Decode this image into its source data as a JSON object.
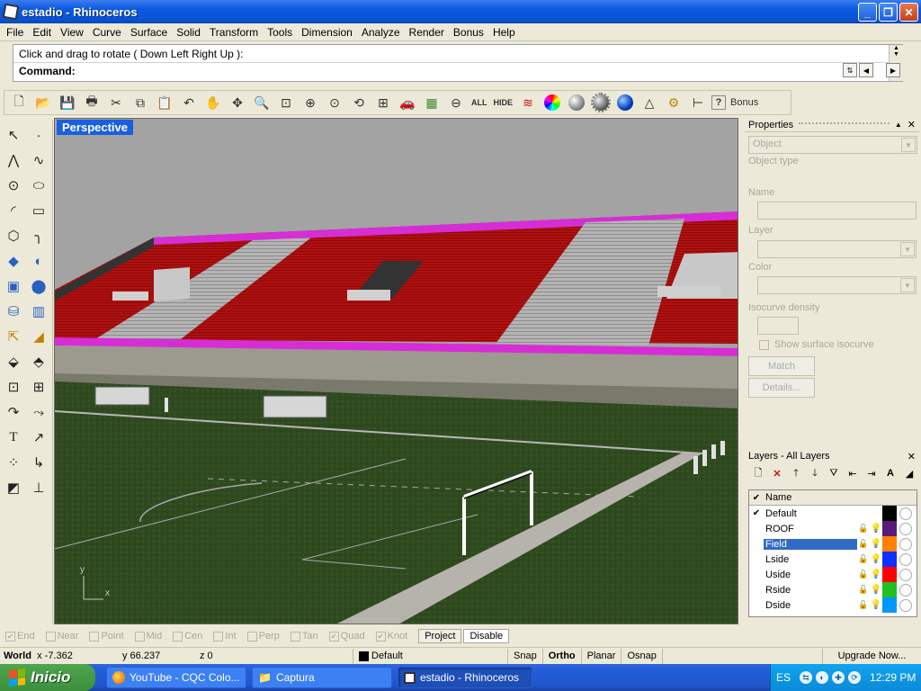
{
  "window": {
    "title": "estadio - Rhinoceros",
    "controls": [
      "_",
      "❐",
      "✕"
    ]
  },
  "menu": [
    "File",
    "Edit",
    "View",
    "Curve",
    "Surface",
    "Solid",
    "Transform",
    "Tools",
    "Dimension",
    "Analyze",
    "Render",
    "Bonus",
    "Help"
  ],
  "command": {
    "history": "Click and drag to rotate ( Down  Left  Right  Up ):",
    "prompt": "Command:"
  },
  "toolbar": {
    "all_label": "ALL",
    "hide_label": "HIDE",
    "bonus_label": "Bonus"
  },
  "viewport": {
    "title": "Perspective",
    "axis_y": "y",
    "axis_x": "x"
  },
  "properties": {
    "title": "Properties",
    "object_combo": "Object",
    "object_type_label": "Object type",
    "name_label": "Name",
    "layer_label": "Layer",
    "color_label": "Color",
    "isocurve_label": "Isocurve density",
    "show_isocurve_label": "Show surface isocurve",
    "match_button": "Match",
    "details_button": "Details..."
  },
  "layers": {
    "title": "Layers - All Layers",
    "name_header": "Name",
    "items": [
      {
        "name": "Default",
        "current": true,
        "color": "#000000"
      },
      {
        "name": "ROOF",
        "current": false,
        "color": "#5a1a7a"
      },
      {
        "name": "Field",
        "current": false,
        "color": "#ff8000",
        "selected": true
      },
      {
        "name": "Lside",
        "current": false,
        "color": "#1030ff"
      },
      {
        "name": "Uside",
        "current": false,
        "color": "#ff0000"
      },
      {
        "name": "Rside",
        "current": false,
        "color": "#20c020"
      },
      {
        "name": "Dside",
        "current": false,
        "color": "#0098ff"
      }
    ]
  },
  "osnap": {
    "items": [
      {
        "label": "End",
        "checked": true
      },
      {
        "label": "Near",
        "checked": false
      },
      {
        "label": "Point",
        "checked": false
      },
      {
        "label": "Mid",
        "checked": false
      },
      {
        "label": "Cen",
        "checked": false
      },
      {
        "label": "Int",
        "checked": false
      },
      {
        "label": "Perp",
        "checked": false
      },
      {
        "label": "Tan",
        "checked": false
      },
      {
        "label": "Quad",
        "checked": true
      },
      {
        "label": "Knot",
        "checked": true
      }
    ],
    "project_label": "Project",
    "disable_label": "Disable"
  },
  "status": {
    "world": "World",
    "x": "x -7.362",
    "y": "y 66.237",
    "z": "z 0",
    "layer": "Default",
    "snap": "Snap",
    "ortho": "Ortho",
    "planar": "Planar",
    "osnap": "Osnap",
    "upgrade": "Upgrade Now..."
  },
  "taskbar": {
    "start": "Inicio",
    "tasks": [
      "YouTube - CQC Colo...",
      "Captura",
      "estadio - Rhinoceros"
    ],
    "lang": "ES",
    "clock": "12:29 PM"
  }
}
